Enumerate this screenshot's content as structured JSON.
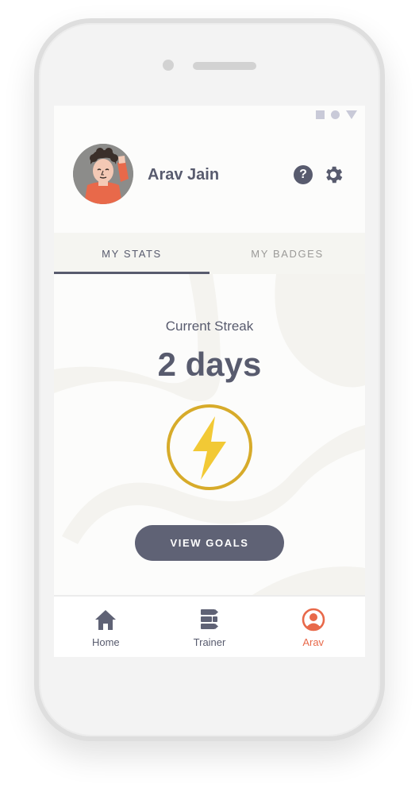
{
  "profile": {
    "name": "Arav Jain",
    "avatar_icon": "person-avatar-icon"
  },
  "header": {
    "help_icon": "?",
    "settings_icon": "gear-icon"
  },
  "tabs": [
    {
      "label": "MY STATS",
      "active": true
    },
    {
      "label": "MY BADGES",
      "active": false
    }
  ],
  "stats": {
    "streak_label": "Current Streak",
    "streak_value": "2 days",
    "streak_icon": "lightning-bolt-icon",
    "view_goals_label": "VIEW GOALS"
  },
  "bottom_nav": {
    "items": [
      {
        "label": "Home",
        "icon": "home-icon",
        "active": false
      },
      {
        "label": "Trainer",
        "icon": "trainer-icon",
        "active": false
      },
      {
        "label": "Arav",
        "icon": "profile-icon",
        "active": true
      }
    ]
  },
  "colors": {
    "primary": "#585b6e",
    "accent": "#e8694a",
    "bolt": "#f2c935",
    "bolt_ring": "#d7ab2a",
    "tab_bg": "#f5f5f1"
  }
}
